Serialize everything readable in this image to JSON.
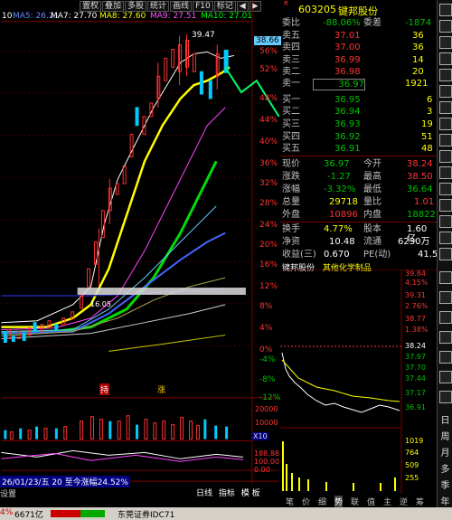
{
  "ma_bar": {
    "ma_num": "10",
    "ma5": "MA5: 26.21",
    "ma7": "MA7: 27.70",
    "ma8": "MA8: 27.60",
    "ma9": "MA9: 27.51",
    "ma10": "MA10: 27.01"
  },
  "toolbar": {
    "buttons": [
      "置权",
      "叠加",
      "多股",
      "统计",
      "画线",
      "F10",
      "标记"
    ],
    "arrows": [
      "◀",
      "▶"
    ]
  },
  "chart": {
    "high_label": "39.47",
    "price_tag": "38.66",
    "low_label": "16.05",
    "pct_labels": [
      "56%",
      "52%",
      "48%",
      "44%",
      "40%",
      "36%",
      "32%",
      "28%",
      "24%",
      "20%",
      "16%",
      "12%",
      "8%",
      "4%",
      "0%",
      "-4%",
      "-8%",
      "-12%"
    ],
    "markers": [
      "持",
      "涨"
    ],
    "vol_labels": [
      "20000",
      "10000",
      "X10"
    ],
    "ind_labels": [
      "188.88",
      "100.00",
      "0.00"
    ],
    "date_info": "26/01/23/五 20 至今涨幅24.52%",
    "bottom_left": "设置",
    "bottom_right": [
      "日线",
      "指标",
      "模",
      "板"
    ]
  },
  "stock": {
    "code": "603205",
    "name": "键邦股份",
    "flag": "R"
  },
  "orderbook": {
    "wei": {
      "label1": "委比",
      "val1": "-88.06%",
      "label2": "委差",
      "val2": "-1874"
    },
    "asks": [
      {
        "label": "卖五",
        "price": "37.01",
        "vol": "36"
      },
      {
        "label": "卖四",
        "price": "37.00",
        "vol": "36"
      },
      {
        "label": "卖三",
        "price": "36.99",
        "vol": "14"
      },
      {
        "label": "卖二",
        "price": "36.98",
        "vol": "20"
      },
      {
        "label": "卖一",
        "price": "36.97",
        "vol": "1921"
      }
    ],
    "bids": [
      {
        "label": "买一",
        "price": "36.95",
        "vol": "6"
      },
      {
        "label": "买二",
        "price": "36.94",
        "vol": "3"
      },
      {
        "label": "买三",
        "price": "36.93",
        "vol": "19"
      },
      {
        "label": "买四",
        "price": "36.92",
        "vol": "51"
      },
      {
        "label": "买五",
        "price": "36.91",
        "vol": "48"
      }
    ]
  },
  "quote": {
    "rows": [
      {
        "l1": "现价",
        "v1": "36.97",
        "l2": "今开",
        "v2": "38.24"
      },
      {
        "l1": "涨跌",
        "v1": "-1.27",
        "l2": "最高",
        "v2": "38.50"
      },
      {
        "l1": "涨幅",
        "v1": "-3.32%",
        "l2": "最低",
        "v2": "36.64"
      },
      {
        "l1": "总量",
        "v1": "29718",
        "l2": "量比",
        "v2": "1.01"
      },
      {
        "l1": "外盘",
        "v1": "10896",
        "l2": "内盘",
        "v2": "18822"
      },
      {
        "l1": "换手",
        "v1": "4.77%",
        "l2": "股本",
        "v2": "1.60亿"
      },
      {
        "l1": "净资",
        "v1": "10.48",
        "l2": "流通",
        "v2": "6230万"
      },
      {
        "l1": "收益(三)",
        "v1": "0.670",
        "l2": "PE(动)",
        "v2": "41.5"
      }
    ]
  },
  "minute": {
    "title": "键邦股份",
    "sector": "其他化学制品",
    "price_labels": [
      "39.84",
      "39.31",
      "38.77",
      "38.24",
      "37.97",
      "37.70",
      "37.44",
      "37.17",
      "36.91"
    ],
    "pct_labels": [
      "4.15%",
      "2.76%",
      "1.38%",
      "0.00%",
      "-0.69%",
      "-1.38%",
      "-2.07%",
      "-2.76%",
      "-3.45%"
    ],
    "vol_labels": [
      "1019",
      "764",
      "509",
      "255"
    ]
  },
  "bottom_tabs": [
    "笔",
    "价",
    "细",
    "势",
    "联",
    "值",
    "主",
    "逆",
    "筹"
  ],
  "sidebar": {
    "chars": [
      "日",
      "周",
      "月",
      "多",
      "季",
      "年"
    ]
  },
  "status": {
    "index_pct": "4%",
    "index_val": "6671亿",
    "broker": "东莞证券IDC71"
  },
  "colors": {
    "up": "#ff3333",
    "down": "#00c000",
    "yellow": "#ffff00",
    "bg": "#000000"
  }
}
